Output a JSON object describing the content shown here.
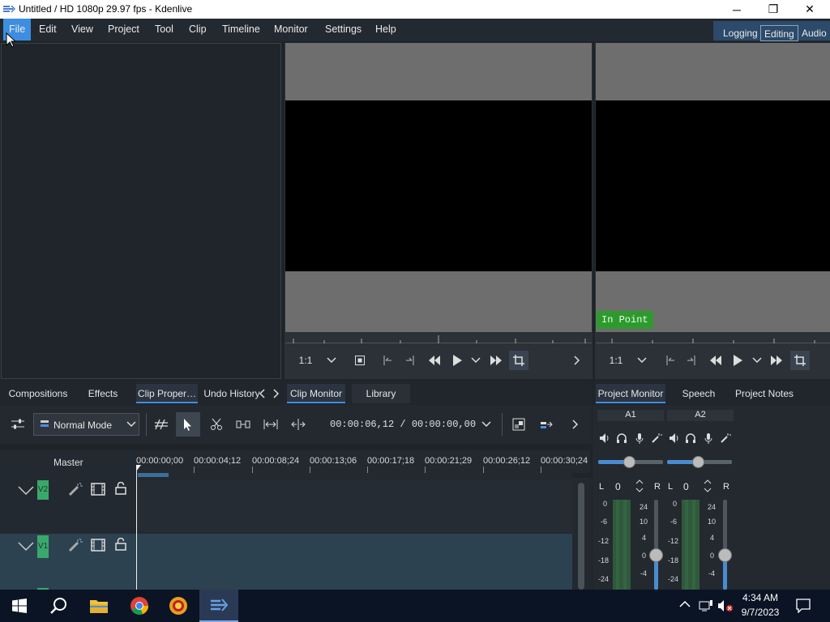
{
  "window": {
    "title": "Untitled / HD 1080p 29.97 fps - Kdenlive",
    "minimize": "─",
    "maximize": "❐",
    "close": "✕"
  },
  "menu": [
    "File",
    "Edit",
    "View",
    "Project",
    "Tool",
    "Clip",
    "Timeline",
    "Monitor",
    "Settings",
    "Help"
  ],
  "layouts": {
    "logging": "Logging",
    "editing": "Editing",
    "audio": "Audio"
  },
  "clip_monitor": {
    "zoom": "1:1"
  },
  "project_monitor": {
    "zoom": "1:1",
    "in_point_label": "In Point"
  },
  "tabs_left": [
    "Compositions",
    "Effects",
    "Clip Proper…",
    "Undo History"
  ],
  "tabs_mid": [
    "Clip Monitor",
    "Library"
  ],
  "tabs_right": [
    "Project Monitor",
    "Speech Editor",
    "Project Notes"
  ],
  "timeline": {
    "mode": "Normal Mode",
    "timecode": "00:00:06,12 / 00:00:00,00",
    "master_label": "Master",
    "ruler": [
      "00:00:00;00",
      "00:00:04;12",
      "00:00:08;24",
      "00:00:13;06",
      "00:00:17;18",
      "00:00:21;29",
      "00:00:26;12",
      "00:00:30;24"
    ],
    "tracks": [
      {
        "name": "V2"
      },
      {
        "name": "V1"
      }
    ]
  },
  "mixer": {
    "channels": [
      {
        "name": "A1",
        "gain": "0",
        "L": "L",
        "R": "R"
      },
      {
        "name": "A2",
        "gain": "0",
        "L": "L",
        "R": "R"
      }
    ],
    "scale_left": [
      "0",
      "-6",
      "-12",
      "-18",
      "-24"
    ],
    "scale_right": [
      "24",
      "10",
      "4",
      "0",
      "-4"
    ]
  },
  "taskbar": {
    "time": "4:34 AM",
    "date": "9/7/2023"
  },
  "colors": {
    "accent": "#3d8ee0",
    "in_point_bg": "#2e9a2e",
    "track_label_bg": "#3aa86b",
    "selected_track": "#2d4250"
  }
}
